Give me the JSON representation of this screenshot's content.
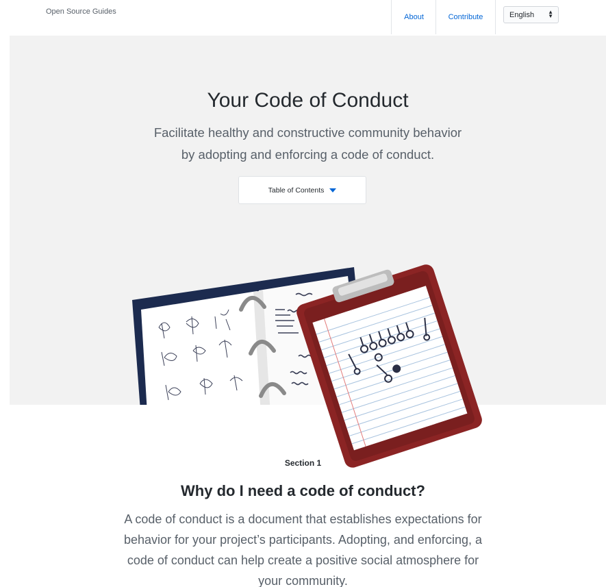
{
  "header": {
    "site_title": "Open Source Guides",
    "nav": {
      "about": "About",
      "contribute": "Contribute"
    },
    "language": "English"
  },
  "hero": {
    "title": "Your Code of Conduct",
    "subtitle_line1": "Facilitate healthy and constructive community behavior",
    "subtitle_line2": "by adopting and enforcing a code of conduct.",
    "toc_label": "Table of Contents"
  },
  "colors": {
    "link": "#0366d6",
    "hero_bg": "#f2f2f2",
    "binder_navy": "#1c2b4f",
    "clipboard_red": "#8b2424"
  },
  "section": {
    "label": "Section 1",
    "title": "Why do I need a code of conduct?",
    "body": "A code of conduct is a document that establishes expectations for behavior for your project’s participants. Adopting, and enforcing, a code of conduct can help create a positive social atmosphere for your community."
  }
}
